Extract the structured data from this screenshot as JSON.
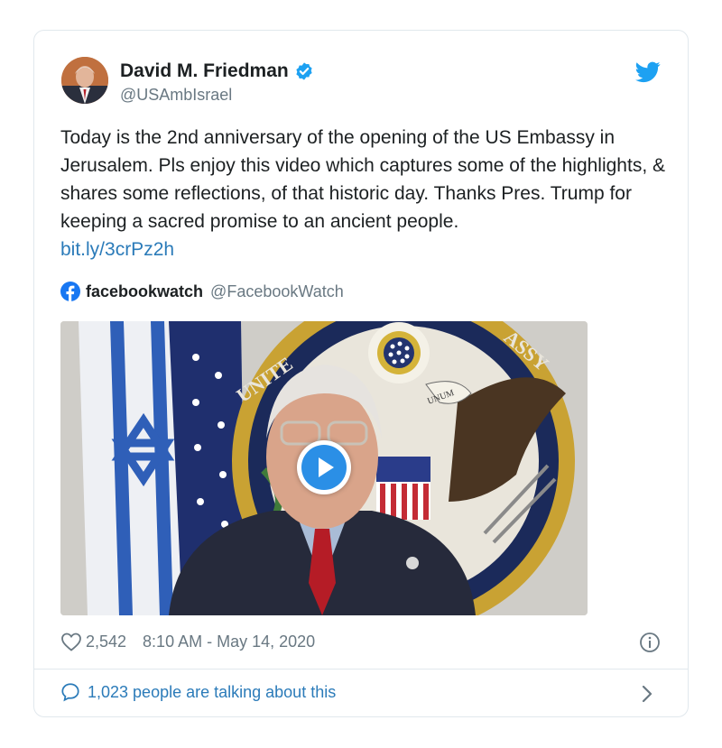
{
  "author": {
    "name": "David M. Friedman",
    "handle": "@USAmbIsrael"
  },
  "tweet": {
    "text": "Today is the 2nd anniversary of the opening of the US Embassy in Jerusalem. Pls enjoy this video which captures some of the highlights, & shares some reflections, of that historic day. Thanks Pres. Trump for keeping a sacred promise to an ancient people.",
    "link": "bit.ly/3crPz2h"
  },
  "media_source": {
    "name": "facebookwatch",
    "handle": "@FacebookWatch"
  },
  "video": {
    "seal_text_left": "UNITE",
    "seal_text_right": "ASSY",
    "ribbon_text": "UNUM"
  },
  "stats": {
    "likes": "2,542",
    "timestamp": "8:10 AM - May 14, 2020"
  },
  "footer": {
    "talking": "1,023 people are talking about this"
  },
  "colors": {
    "link": "#2b7bb9",
    "twitter_blue": "#1da1f2",
    "verified": "#1da1f2",
    "play_button": "#2b8fe6",
    "text": "#1c2022",
    "muted": "#697882"
  },
  "icons": [
    "verified-badge-icon",
    "twitter-bird-icon",
    "facebook-icon",
    "play-icon",
    "heart-icon",
    "info-icon",
    "speech-bubble-icon",
    "chevron-right-icon"
  ]
}
